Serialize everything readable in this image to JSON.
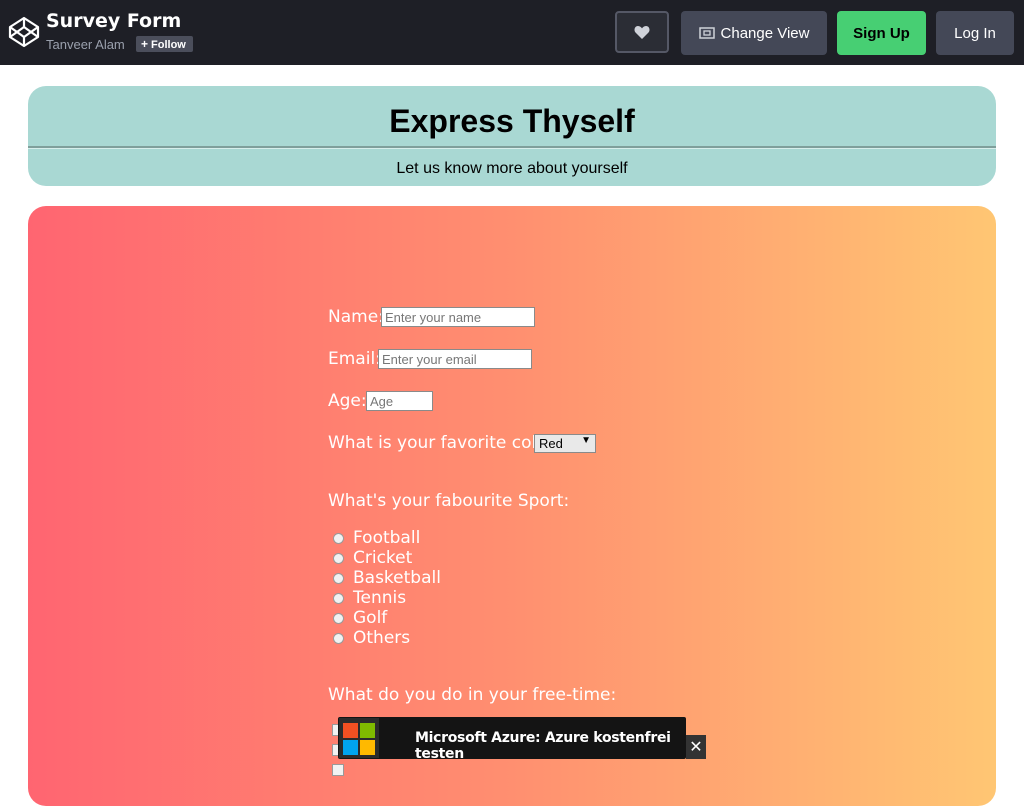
{
  "topbar": {
    "title": "Survey Form",
    "author": "Tanveer Alam",
    "follow_label": "Follow",
    "change_view_label": "Change View",
    "signup_label": "Sign Up",
    "login_label": "Log In"
  },
  "header": {
    "title": "Express Thyself",
    "subtitle": "Let us know more about yourself"
  },
  "form": {
    "name_label": "Name:",
    "name_placeholder": "Enter your name",
    "email_label": "Email:",
    "email_placeholder": "Enter your email",
    "age_label": "Age:",
    "age_placeholder": "Age",
    "color_label": "What is your favorite color:",
    "color_selected": "Red",
    "sport_label": "What's your fabourite Sport:",
    "sports": [
      "Football",
      "Cricket",
      "Basketball",
      "Tennis",
      "Golf",
      "Others"
    ],
    "freetime_label": "What do you do in your free-time:"
  },
  "ad": {
    "text": "Microsoft Azure: Azure kostenfrei testen",
    "close_symbol": "✕"
  },
  "colors": {
    "topbar_bg": "#1e1f26",
    "signup_green": "#47cf73",
    "header_teal": "#a9d8d3",
    "gradient_start": "#ff6571",
    "gradient_end": "#ffc673"
  }
}
